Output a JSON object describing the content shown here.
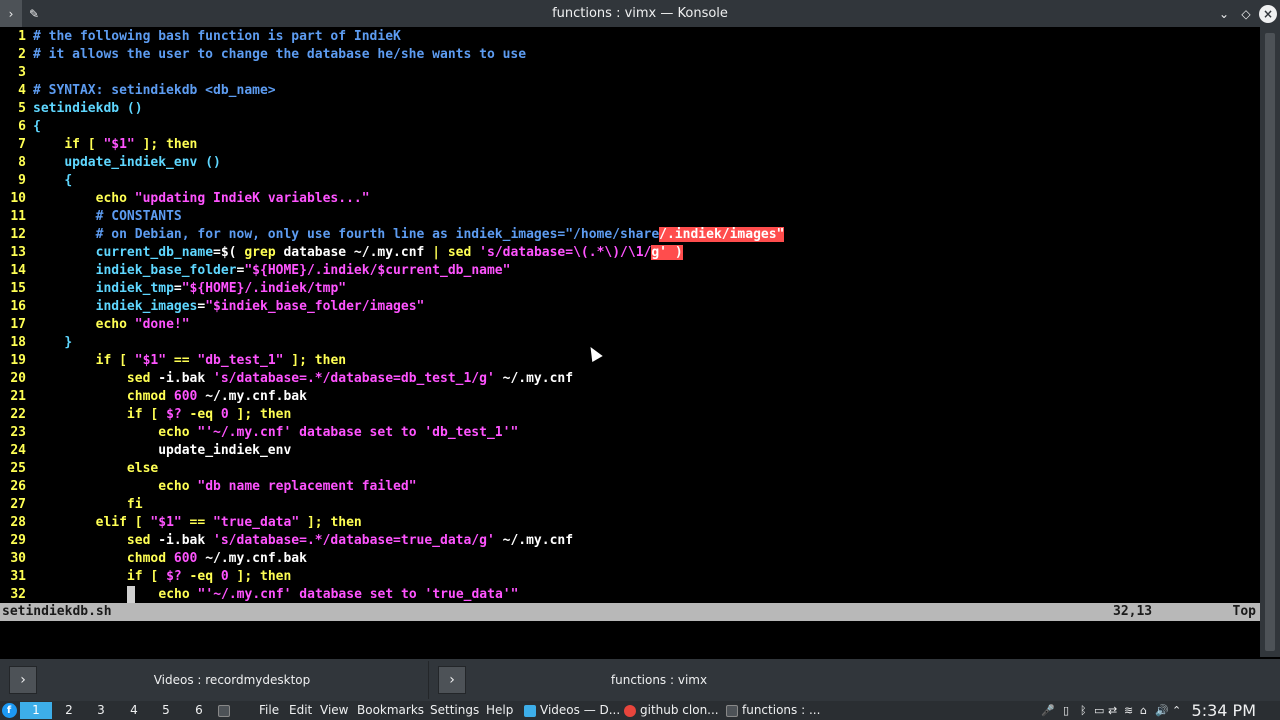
{
  "window": {
    "title": "functions : vimx — Konsole",
    "menu_icon": "konsole-menu-icon",
    "pin_icon": "pin-icon",
    "minimize_icon": "minimize-icon",
    "maximize_icon": "maximize-icon",
    "close_icon": "close-icon"
  },
  "editor": {
    "lines": [
      {
        "n": "1"
      },
      {
        "n": "2"
      },
      {
        "n": "3"
      },
      {
        "n": "4"
      },
      {
        "n": "5"
      },
      {
        "n": "6"
      },
      {
        "n": "7"
      },
      {
        "n": "8"
      },
      {
        "n": "9"
      },
      {
        "n": "10"
      },
      {
        "n": "11"
      },
      {
        "n": "12"
      },
      {
        "n": "13"
      },
      {
        "n": "14"
      },
      {
        "n": "15"
      },
      {
        "n": "16"
      },
      {
        "n": "17"
      },
      {
        "n": "18"
      },
      {
        "n": "19"
      },
      {
        "n": "20"
      },
      {
        "n": "21"
      },
      {
        "n": "22"
      },
      {
        "n": "23"
      },
      {
        "n": "24"
      },
      {
        "n": "25"
      },
      {
        "n": "26"
      },
      {
        "n": "27"
      },
      {
        "n": "28"
      },
      {
        "n": "29"
      },
      {
        "n": "30"
      },
      {
        "n": "31"
      },
      {
        "n": "32"
      }
    ],
    "code": {
      "l1": "# the following bash function is part of IndieK",
      "l2": "# it allows the user to change the database he/she wants to use",
      "l4": "# SYNTAX: setindiekdb <db_name>",
      "l5": "setindiekdb ()",
      "l6": "{",
      "l7_kw1": "if",
      "l7_a": " [ ",
      "l7_s": "\"$1\"",
      "l7_b": " ]; ",
      "l7_kw2": "then",
      "l8": "update_indiek_env ()",
      "l9": "{",
      "l10_kw": "echo",
      "l10_s": "\"updating IndieK variables...\"",
      "l11": "# CONSTANTS",
      "l12_c": "# on Debian, for now, only use fourth line as indiek_images=\"/home/share",
      "l12_hl": "/.indiek/images\"",
      "l13_v": "current_db_name",
      "l13_a": "=$( ",
      "l13_kw1": "grep",
      "l13_b": " database ~/.my.cnf ",
      "l13_pipe": "|",
      "l13_kw2": " sed",
      "l13_s1": " 's/database=\\(.*\\)/\\1/",
      "l13_hl": "g' )",
      "l14_v": "indiek_base_folder",
      "l14_a": "=",
      "l14_s": "\"${HOME}/.indiek/$current_db_name\"",
      "l15_v": "indiek_tmp",
      "l15_a": "=",
      "l15_s": "\"${HOME}/.indiek/tmp\"",
      "l16_v": "indiek_images",
      "l16_a": "=",
      "l16_s": "\"$indiek_base_folder/images\"",
      "l17_kw": "echo",
      "l17_s": "\"done!\"",
      "l18": "}",
      "l19_kw1": "if",
      "l19_a": " [ ",
      "l19_s1": "\"$1\"",
      "l19_b": " == ",
      "l19_s2": "\"db_test_1\"",
      "l19_c": " ]; ",
      "l19_kw2": "then",
      "l20_kw": "sed",
      "l20_a": " -i.bak ",
      "l20_s": "'s/database=.*/database=db_test_1/g'",
      "l20_b": " ~/.my.cnf",
      "l21_kw": "chmod",
      "l21_n": " 600",
      "l21_a": " ~/.my.cnf.bak",
      "l22_kw1": "if",
      "l22_a": " [ ",
      "l22_s": "$?",
      "l22_b": " -eq ",
      "l22_n": "0",
      "l22_c": " ]; ",
      "l22_kw2": "then",
      "l23_kw": "echo",
      "l23_s": "\"'~/.my.cnf' database set to 'db_test_1'\"",
      "l24": "update_indiek_env",
      "l25_kw": "else",
      "l26_kw": "echo",
      "l26_s": "\"db name replacement failed\"",
      "l27_kw": "fi",
      "l28_kw1": "elif",
      "l28_a": " [ ",
      "l28_s1": "\"$1\"",
      "l28_b": " == ",
      "l28_s2": "\"true_data\"",
      "l28_c": " ]; ",
      "l28_kw2": "then",
      "l29_kw": "sed",
      "l29_a": " -i.bak ",
      "l29_s": "'s/database=.*/database=true_data/g'",
      "l29_b": " ~/.my.cnf",
      "l30_kw": "chmod",
      "l30_n": " 600",
      "l30_a": " ~/.my.cnf.bak",
      "l31_kw1": "if",
      "l31_a": " [ ",
      "l31_s": "$?",
      "l31_b": " -eq ",
      "l31_n": "0",
      "l31_c": " ]; ",
      "l31_kw2": "then",
      "l32_kw": "echo",
      "l32_s": "\"'~/.my.cnf' database set to 'true_data'\""
    },
    "status": {
      "filename": "setindiekdb.sh",
      "position": "32,13",
      "scroll": "Top"
    }
  },
  "tabs": [
    {
      "label": "Videos : recordmydesktop",
      "icon": "terminal-prompt-icon"
    },
    {
      "label": "functions : vimx",
      "icon": "terminal-prompt-icon"
    }
  ],
  "panel": {
    "desktops": [
      "1",
      "2",
      "3",
      "4",
      "5",
      "6"
    ],
    "menus": [
      "File",
      "Edit",
      "View",
      "Bookmarks",
      "Settings",
      "Help"
    ],
    "tasks": [
      "Videos — D...",
      "github clon...",
      "functions : ..."
    ],
    "clock": "5:34 PM"
  },
  "colors": {
    "comment": "#5d9cf1",
    "string": "#ff54ff",
    "keyword": "#ffff54",
    "variable": "#5fd7ff",
    "highlight": "#ff4d4d",
    "statusline": "#b8b8b8",
    "active_desktop": "#3daee9"
  }
}
